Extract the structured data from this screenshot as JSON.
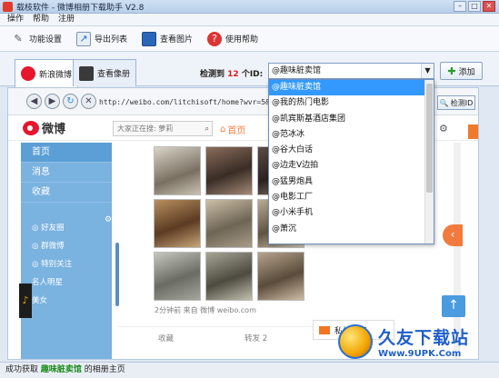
{
  "window": {
    "title": "载枝软件 - 微博相册下载助手 V2.8",
    "btn_min": "–",
    "btn_max": "□",
    "btn_close": "✕"
  },
  "menu": [
    "操作",
    "帮助",
    "注册"
  ],
  "toolbar": {
    "settings": "功能设置",
    "export": "导出列表",
    "view": "查看图片",
    "help": "使用帮助"
  },
  "tabs": [
    {
      "label": "新浪微博"
    },
    {
      "label": "查看像册"
    }
  ],
  "detect": {
    "prefix": "检测到",
    "count": "12",
    "suffix": "个ID:"
  },
  "combo": {
    "value": "@趣味脏卖馆"
  },
  "add_label": "添加",
  "browser": {
    "url": "http://weibo.com/litchisoft/home?wvr=5&lf=reg",
    "detect_btn": "检测ID"
  },
  "weibo": {
    "logo": "微博",
    "search_placeholder": "大家正在搜: 萝莉",
    "home": "首页",
    "sidebar_main": [
      "首页",
      "消息",
      "收藏"
    ],
    "sidebar_sub": [
      "◎ 好友圈",
      "◎ 群微博",
      "◎ 特别关注",
      "名人明星",
      "美女"
    ],
    "caption": "2分钟前 来自 微博 weibo.com",
    "actions": [
      "收藏",
      "转发 2"
    ],
    "private_msg": "私信聊天"
  },
  "dropdown": [
    "@趣味脏卖馆",
    "@我的热门电影",
    "@凯宾斯基酒店集团",
    "@范冰冰",
    "@谷大白话",
    "@边走V边拍",
    "@猛男炮具",
    "@电影工厂",
    "@小米手机",
    "@萧沉"
  ],
  "status": {
    "prefix": "成功获取",
    "name": "趣味脏卖馆",
    "suffix": "的相册主页"
  },
  "watermark": {
    "big": "久友下载站",
    "small": "Www.9UPK.Com"
  },
  "colors": {
    "accent": "#3399ff",
    "weibo_red": "#e6162d",
    "sidebar": "#7ab2e0",
    "status_green": "#1a8a1a"
  }
}
